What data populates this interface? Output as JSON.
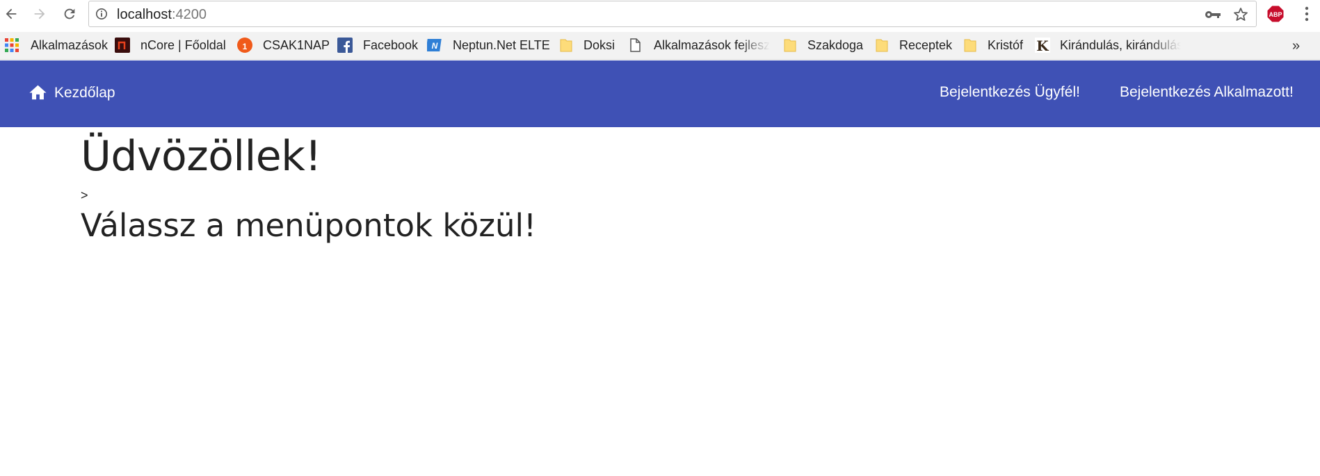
{
  "browser": {
    "url_host": "localhost",
    "url_port": ":4200"
  },
  "bookmarks": [
    {
      "label": "Alkalmazások",
      "icon": "apps-grid-icon"
    },
    {
      "label": "nCore | Főoldal",
      "icon": "ncore-icon"
    },
    {
      "label": "CSAK1NAP",
      "icon": "csak1nap-icon"
    },
    {
      "label": "Facebook",
      "icon": "facebook-icon"
    },
    {
      "label": "Neptun.Net ELTE",
      "icon": "neptun-icon"
    },
    {
      "label": "Doksi",
      "icon": "folder-icon"
    },
    {
      "label": "Alkalmazások fejleszté",
      "icon": "page-icon"
    },
    {
      "label": "Szakdoga",
      "icon": "folder-icon"
    },
    {
      "label": "Receptek",
      "icon": "folder-icon"
    },
    {
      "label": "Kristóf",
      "icon": "folder-icon"
    },
    {
      "label": "Kirándulás, kirándulás",
      "icon": "kirandulas-icon"
    }
  ],
  "bookmarks_overflow": "»",
  "header": {
    "home_label": "Kezdőlap",
    "login_customer": "Bejelentkezés Ügyfél!",
    "login_employee": "Bejelentkezés Alkalmazott!",
    "color": "#3f51b5"
  },
  "main": {
    "title": "Üdvözöllek!",
    "marker": ">",
    "subtitle": "Válassz a menüpontok közül!"
  }
}
